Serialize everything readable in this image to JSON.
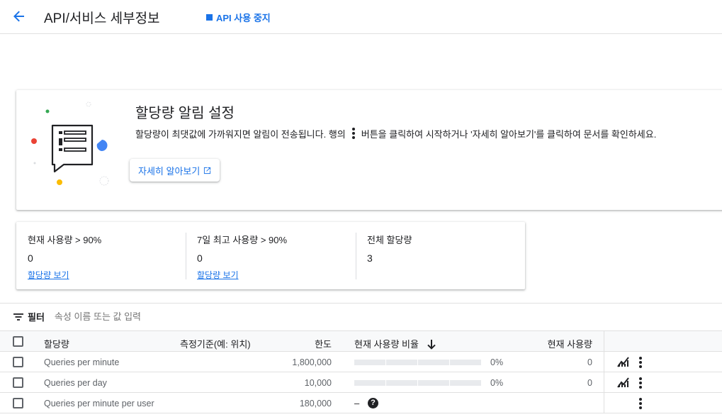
{
  "header": {
    "title": "API/서비스 세부정보",
    "stop_label": "API 사용 중지"
  },
  "alert_card": {
    "title": "할당량 알림 설정",
    "desc_before": "할당량이 최댓값에 가까워지면 알림이 전송됩니다. 행의",
    "desc_after": "버튼을 클릭하여 시작하거나 '자세히 알아보기'를 클릭하여 문서를 확인하세요.",
    "learn_more": "자세히 알아보기"
  },
  "stats": [
    {
      "label": "현재 사용량 > 90%",
      "value": "0",
      "link": "할당량 보기"
    },
    {
      "label": "7일 최고 사용량 > 90%",
      "value": "0",
      "link": "할당량 보기"
    },
    {
      "label": "전체 할당량",
      "value": "3",
      "link": ""
    }
  ],
  "filter": {
    "label": "필터",
    "placeholder": "속성 이름 또는 값 입력"
  },
  "table": {
    "columns": [
      "할당량",
      "측정기준(예: 위치)",
      "한도",
      "현재 사용량 비율",
      "현재 사용량"
    ],
    "rows": [
      {
        "name": "Queries per minute",
        "limit": "1,800,000",
        "ratio": "0%",
        "current": "0"
      },
      {
        "name": "Queries per day",
        "limit": "10,000",
        "ratio": "0%",
        "current": "0"
      },
      {
        "name": "Queries per minute per user",
        "limit": "180,000",
        "ratio": "–",
        "current": ""
      }
    ]
  },
  "colors": {
    "accent": "#1a73e8",
    "text": "#202124",
    "muted": "#5f6368"
  }
}
